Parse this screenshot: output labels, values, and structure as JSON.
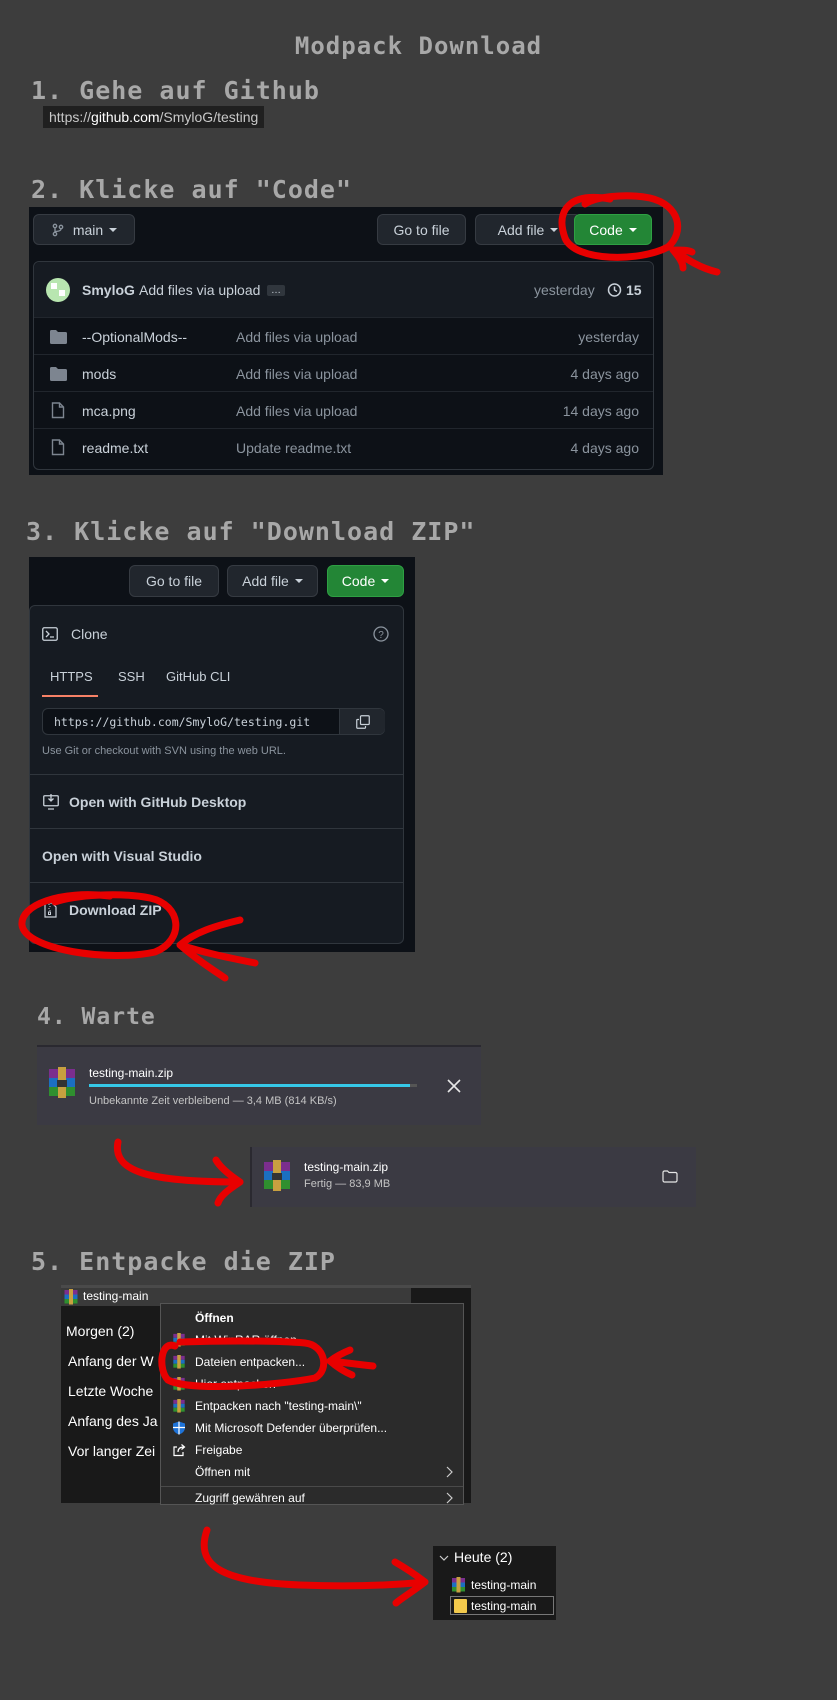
{
  "title": "Modpack Download",
  "steps": {
    "s1": "1. Gehe auf Github",
    "s2": "2. Klicke auf \"Code\"",
    "s3": "3. Klicke auf \"Download ZIP\"",
    "s4": "4. Warte",
    "s5": "5. Entpacke die ZIP"
  },
  "url": {
    "prefix": "https://",
    "domain": "github.com",
    "path": "/SmyloG/testing"
  },
  "repo": {
    "branch": "main",
    "go_to_file": "Go to file",
    "add_file": "Add file",
    "code": "Code",
    "commit_user": "SmyloG",
    "commit_msg": "Add files via upload",
    "commit_more": "…",
    "commit_time": "yesterday",
    "commit_count": "15",
    "files": [
      {
        "name": "--OptionalMods--",
        "msg": "Add files via upload",
        "time": "yesterday",
        "icon": "folder-icon"
      },
      {
        "name": "mods",
        "msg": "Add files via upload",
        "time": "4 days ago",
        "icon": "folder-icon"
      },
      {
        "name": "mca.png",
        "msg": "Add files via upload",
        "time": "14 days ago",
        "icon": "file-icon"
      },
      {
        "name": "readme.txt",
        "msg": "Update readme.txt",
        "time": "4 days ago",
        "icon": "file-icon"
      }
    ]
  },
  "clone": {
    "go_to_file": "Go to file",
    "add_file": "Add file",
    "code": "Code",
    "title": "Clone",
    "tabs": [
      "HTTPS",
      "SSH",
      "GitHub CLI"
    ],
    "url": "https://github.com/SmyloG/testing.git",
    "hint": "Use Git or checkout with SVN using the web URL.",
    "desktop": "Open with GitHub Desktop",
    "vs": "Open with Visual Studio",
    "zip": "Download ZIP"
  },
  "download": {
    "file": "testing-main.zip",
    "progress_text": "Unbekannte Zeit verbleibend — 3,4 MB (814 KB/s)",
    "progress": 0.98,
    "done_text": "Fertig — 83,9 MB"
  },
  "explorer": {
    "file": "testing-main",
    "groups": [
      "Morgen (2)",
      "Anfang der W",
      "Letzte Woche",
      "Anfang des Ja",
      "Vor langer Zei"
    ],
    "menu": [
      "Öffnen",
      "Mit WinRAR öffnen",
      "Dateien entpacken...",
      "Hier entpacken",
      "Entpacken nach \"testing-main\\\"",
      "Mit Microsoft Defender überprüfen...",
      "Freigabe",
      "Öffnen mit",
      "Zugriff gewähren auf"
    ],
    "result_group": "Heute (2)",
    "result_items": [
      "testing-main",
      "testing-main"
    ]
  },
  "colors": {
    "annotation": "#e80000",
    "accent_green": "#238636",
    "progress": "#36c8e8"
  }
}
